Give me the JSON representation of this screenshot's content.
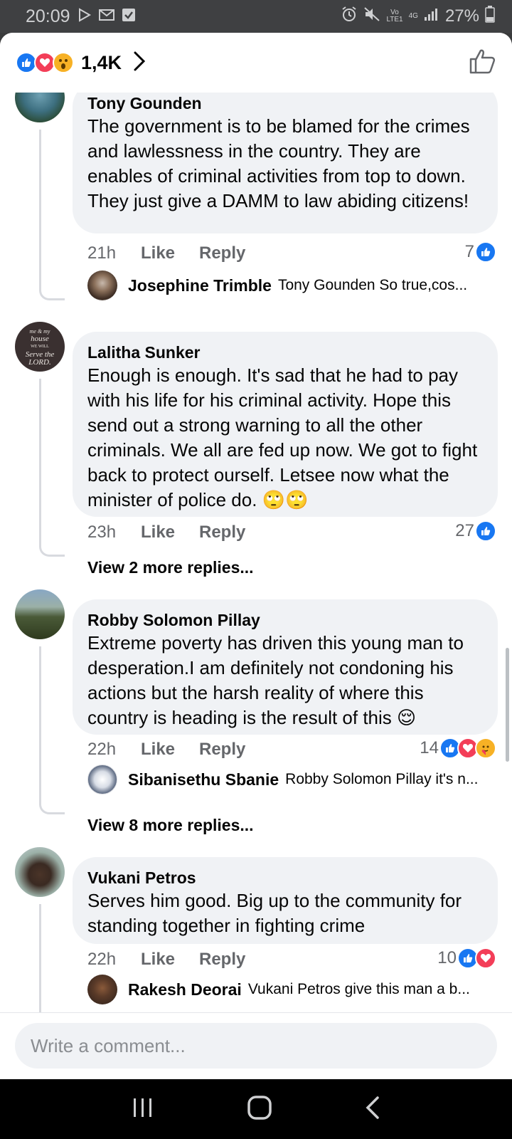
{
  "status_bar": {
    "time": "20:09",
    "network_top": "Vo",
    "network_bottom": "LTE1",
    "network_gen": "4G",
    "battery": "27%"
  },
  "header": {
    "reaction_count": "1,4K",
    "reactions": [
      "like",
      "love",
      "wow"
    ],
    "accent_color": "#1877f2"
  },
  "comments": [
    {
      "author": "Tony Gounden",
      "text": "The government is to be blamed for the crimes and lawlessness in the country. They are enables of criminal activities from top to down.  They just give a DAMM to law abiding citizens!",
      "time": "21h",
      "like_label": "Like",
      "reply_label": "Reply",
      "reaction_count": "7",
      "reactions": [
        "like"
      ],
      "reply_preview": {
        "author": "Josephine Trimble",
        "text": "Tony Gounden So true,cos..."
      }
    },
    {
      "author": "Lalitha Sunker",
      "text": "Enough is enough. It's sad that he had to pay with his life for his criminal activity. Hope this send out a strong warning to all the other criminals. We all are fed up now. We got to fight back to protect ourself. Letsee now what the minister of police do. 🙄🙄",
      "time": "23h",
      "like_label": "Like",
      "reply_label": "Reply",
      "reaction_count": "27",
      "reactions": [
        "like"
      ],
      "avatar_text": [
        "me & my",
        "house",
        "WE WILL",
        "Serve the",
        "LORD."
      ],
      "view_more": "View 2 more replies..."
    },
    {
      "author": "Robby Solomon Pillay",
      "text": "Extreme poverty has driven this young man to desperation.I am definitely not condoning his actions but the harsh reality of where this country is heading is the result of this 😌",
      "time": "22h",
      "like_label": "Like",
      "reply_label": "Reply",
      "reaction_count": "14",
      "reactions": [
        "like",
        "love",
        "care"
      ],
      "reply_preview": {
        "author": "Sibanisethu Sbanie",
        "text": "Robby Solomon Pillay it's n..."
      },
      "view_more": "View 8 more replies..."
    },
    {
      "author": "Vukani Petros",
      "text": "Serves him good. Big up to the community for standing together in fighting crime",
      "time": "22h",
      "like_label": "Like",
      "reply_label": "Reply",
      "reaction_count": "10",
      "reactions": [
        "like",
        "love"
      ],
      "reply_preview": {
        "author": "Rakesh Deorai",
        "text": "Vukani Petros give this man a b..."
      }
    }
  ],
  "composer": {
    "placeholder": "Write a comment..."
  },
  "nav": {
    "icons": [
      "recent-apps-icon",
      "home-icon",
      "back-icon"
    ]
  }
}
